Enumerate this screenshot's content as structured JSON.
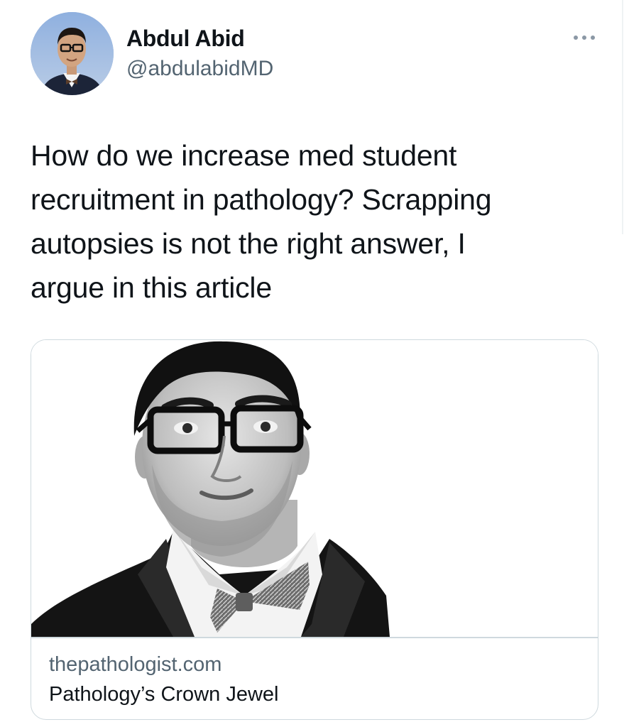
{
  "author": {
    "display_name": "Abdul Abid",
    "handle": "@abdulabidMD",
    "avatar_icon": "profile-photo"
  },
  "menu": {
    "more_icon": "more-horizontal-icon"
  },
  "tweet": {
    "text": "How do we increase med student\nrecruitment in pathology? Scrapping\nautopsies is not the right answer, I\nargue in this article"
  },
  "link_card": {
    "domain": "thepathologist.com",
    "title": "Pathology’s Crown Jewel",
    "image_description_icon": "article-photo"
  },
  "colors": {
    "text_primary": "#0f1419",
    "text_secondary": "#536471",
    "border": "#cfd9de"
  }
}
